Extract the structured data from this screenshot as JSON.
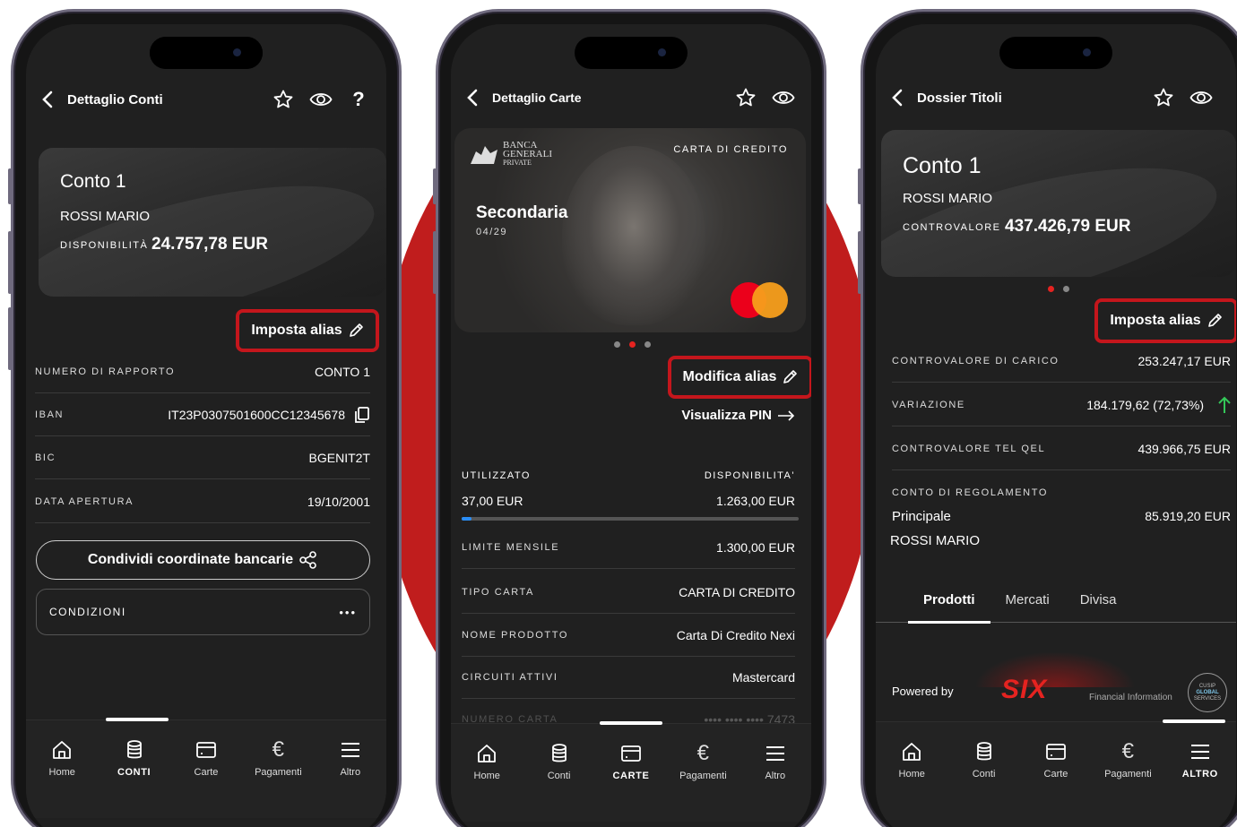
{
  "colors": {
    "accent_red": "#c01d1d",
    "highlight": "#c4161c",
    "progress": "#2a8df5",
    "screen_bg": "#202020"
  },
  "phone1": {
    "title": "Dettaglio Conti",
    "help": "?",
    "hero": {
      "title": "Conto 1",
      "name": "ROSSI MARIO",
      "caption": "DISPONIBILITÀ",
      "value": "24.757,78 EUR"
    },
    "alias": "Imposta alias",
    "rows": [
      {
        "k": "NUMERO DI RAPPORTO",
        "v": "CONTO 1"
      },
      {
        "k": "IBAN",
        "v": "IT23P0307501600CC12345678"
      },
      {
        "k": "BIC",
        "v": "BGENIT2T"
      },
      {
        "k": "DATA APERTURA",
        "v": "19/10/2001"
      }
    ],
    "share_btn": "Condividi coordinate bancarie",
    "conditions": "CONDIZIONI",
    "conditions_more": "•••",
    "nav": [
      "Home",
      "CONTI",
      "Carte",
      "Pagamenti",
      "Altro"
    ]
  },
  "phone2": {
    "title": "Dettaglio Carte",
    "card": {
      "bank_line1": "BANCA",
      "bank_line2": "GENERALI",
      "bank_line3": "PRIVATE",
      "type": "CARTA DI CREDITO",
      "name": "Secondaria",
      "expiry": "04/29"
    },
    "alias": "Modifica alias",
    "pin": "Visualizza PIN",
    "used_label": "UTILIZZATO",
    "avail_label": "DISPONIBILITA'",
    "used_value": "37,00 EUR",
    "avail_value": "1.263,00 EUR",
    "used_fraction": 0.028,
    "rows": [
      {
        "k": "LIMITE MENSILE",
        "v": "1.300,00 EUR"
      },
      {
        "k": "TIPO CARTA",
        "v": "CARTA DI CREDITO"
      },
      {
        "k": "NOME PRODOTTO",
        "v": "Carta Di Credito Nexi"
      },
      {
        "k": "CIRCUITI ATTIVI",
        "v": "Mastercard"
      },
      {
        "k": "NUMERO CARTA",
        "v": "•••• •••• •••• 7473"
      }
    ],
    "nav": [
      "Home",
      "Conti",
      "CARTE",
      "Pagamenti",
      "Altro"
    ]
  },
  "phone3": {
    "title": "Dossier Titoli",
    "hero": {
      "title": "Conto 1",
      "name": "ROSSI MARIO",
      "caption": "CONTROVALORE",
      "value": "437.426,79 EUR"
    },
    "alias": "Imposta alias",
    "rows": [
      {
        "k": "CONTROVALORE DI CARICO",
        "v": "253.247,17 EUR"
      },
      {
        "k": "VARIAZIONE",
        "v": "184.179,62 (72,73%)"
      },
      {
        "k": "CONTROVALORE TEL QEL",
        "v": "439.966,75 EUR"
      }
    ],
    "regolamento": {
      "k": "CONTO DI REGOLAMENTO",
      "sub": "Principale",
      "v": "85.919,20 EUR",
      "owner": "ROSSI MARIO"
    },
    "tabs": [
      "Prodotti",
      "Mercati",
      "Divisa"
    ],
    "powered": "Powered by",
    "six": "SIX",
    "fin_info": "Financial Information",
    "cusip_1": "CUSIP",
    "cusip_2": "GLOBAL",
    "cusip_3": "SERVICES",
    "nav": [
      "Home",
      "Conti",
      "Carte",
      "Pagamenti",
      "ALTRO"
    ]
  }
}
